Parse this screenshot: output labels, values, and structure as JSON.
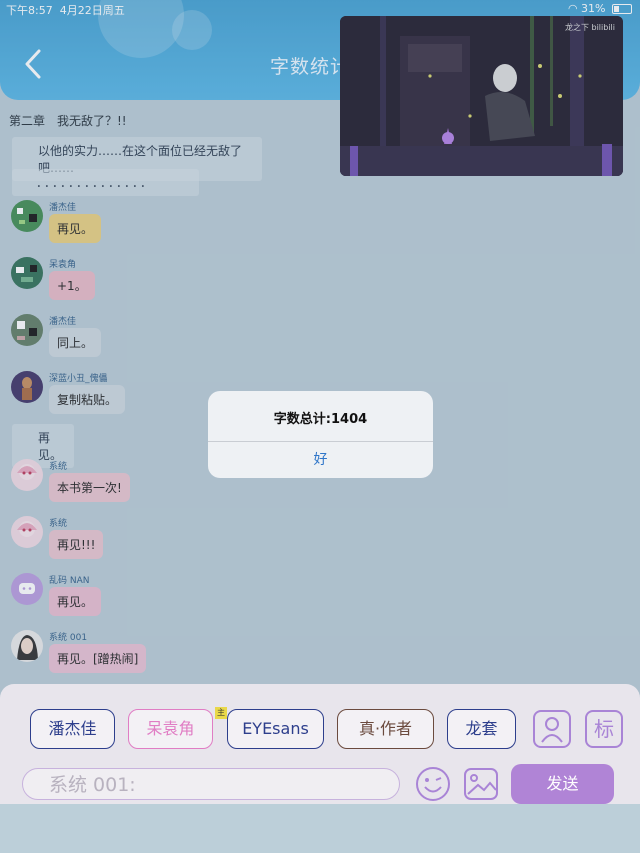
{
  "status": {
    "time": "下午8:57",
    "date": "4月22日周五",
    "battery": "31%"
  },
  "header": {
    "title": "字数统计"
  },
  "video": {
    "watermark": "龙之下 bilibili"
  },
  "chat": {
    "chapter_line": "第二章　我无敌了？!!",
    "narration1": "以他的实力……在这个面位已经无敌了吧……",
    "narration2": "．．．．．．．．．．．．．．",
    "messages": [
      {
        "name": "潘杰佳",
        "text": "再见。",
        "bubble": "#e8cf7e"
      },
      {
        "name": "呆袁角",
        "text": "+1。",
        "bubble": "#e8b9c6"
      },
      {
        "name": "潘杰佳",
        "text": "同上。",
        "bubble": "#ccd7df"
      },
      {
        "name": "深蓝小丑_傀儡",
        "text": "复制粘贴。",
        "bubble": "#ccd7df"
      }
    ],
    "narration3": "再见。",
    "messages2": [
      {
        "name": "系统",
        "text": "本书第一次!",
        "bubble": "#e8c4cf"
      },
      {
        "name": "系统",
        "text": "再见!!!",
        "bubble": "#e8c4cf"
      },
      {
        "name": "乱码 NAN",
        "text": "再见。",
        "bubble": "#e8bcd0"
      },
      {
        "name": "系统 001",
        "text": "再见。[蹭热闹]",
        "bubble": "#e8c0d3"
      }
    ]
  },
  "alert": {
    "title": "字数总计:1404",
    "ok": "好"
  },
  "panel": {
    "roles": [
      {
        "label": "潘杰佳",
        "color": "#2d3e8c"
      },
      {
        "label": "呆袁角",
        "color": "#e07dc4"
      },
      {
        "label": "EYEsans",
        "color": "#2d3e8c"
      },
      {
        "label": "真·作者",
        "color": "#6b4a3e"
      },
      {
        "label": "龙套",
        "color": "#2d3e8c"
      }
    ],
    "crown_badge": "主",
    "tag_icon_label": "标",
    "input_placeholder": "系统 001:",
    "send_label": "发送"
  }
}
